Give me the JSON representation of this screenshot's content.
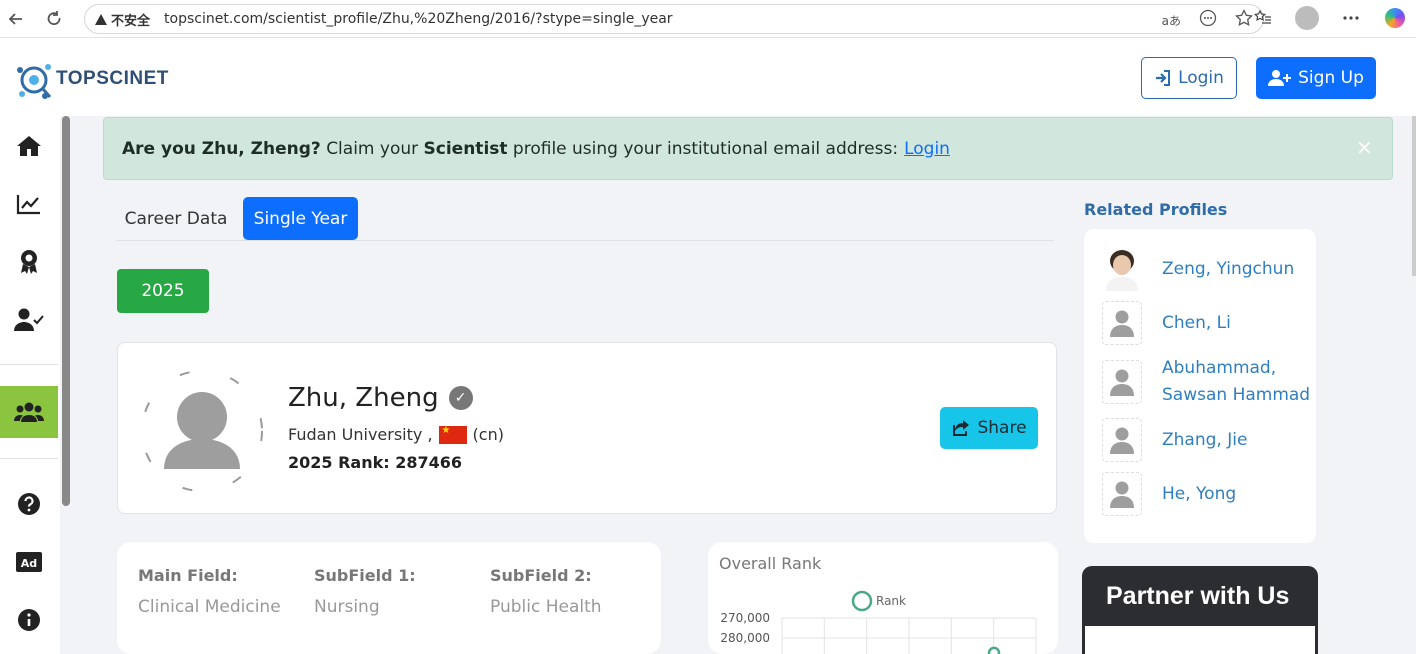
{
  "browser": {
    "security_label": "不安全",
    "url": "topscinet.com/scientist_profile/Zhu,%20Zheng/2016/?stype=single_year",
    "read_aloud_label": "aあ"
  },
  "header": {
    "logo_text": "TOPSCINET",
    "login_label": "Login",
    "signup_label": "Sign Up"
  },
  "alert": {
    "q_bold": "Are you Zhu, Zheng?",
    "text1": "Claim your",
    "bold2": "Scientist",
    "text2": "profile using your institutional email address:",
    "link": "Login",
    "close": "×"
  },
  "tabs": {
    "career": "Career Data",
    "single": "Single Year"
  },
  "year_button": "2025",
  "profile": {
    "name": "Zhu, Zheng",
    "institution": "Fudan University ,",
    "country_code": "(cn)",
    "rank_line": "2025 Rank: 287466",
    "share_label": "Share",
    "verified_mark": "✓"
  },
  "fields": [
    {
      "label": "Main Field:",
      "value": "Clinical Medicine"
    },
    {
      "label": "SubField 1:",
      "value": "Nursing"
    },
    {
      "label": "SubField 2:",
      "value": "Public Health"
    }
  ],
  "chart_data": {
    "type": "line",
    "title": "Overall Rank",
    "series": [
      {
        "name": "Rank",
        "values": [
          287466
        ]
      }
    ],
    "y_ticks": [
      "270,000",
      "280,000"
    ],
    "yaxis_reversed": true,
    "legend": "top",
    "color": "#4aa88a"
  },
  "related": {
    "title": "Related Profiles",
    "items": [
      {
        "name": "Zeng, Yingchun",
        "has_photo": true
      },
      {
        "name": "Chen, Li",
        "has_photo": false
      },
      {
        "name": "Abuhammad, Sawsan Hammad",
        "has_photo": false
      },
      {
        "name": "Zhang, Jie",
        "has_photo": false
      },
      {
        "name": "He, Yong",
        "has_photo": false
      }
    ]
  },
  "partner_title": "Partner with Us",
  "colors": {
    "primary": "#0d6efd",
    "success": "#28a745",
    "share": "#17c5e8",
    "sidebar_active": "#8bc53f",
    "alert_bg": "#d1e7dd"
  }
}
